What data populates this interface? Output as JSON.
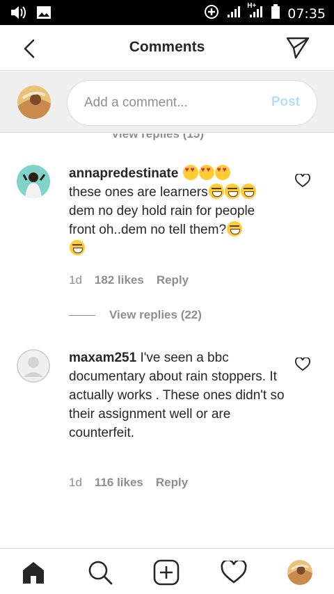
{
  "status_bar": {
    "time": "07:35",
    "network": "H+",
    "icons": [
      "volume-icon",
      "image-icon",
      "data-saver-icon",
      "signal-icon",
      "signal-icon",
      "battery-icon"
    ]
  },
  "header": {
    "title": "Comments",
    "back_icon": "chevron-left-icon",
    "share_icon": "send-icon"
  },
  "composer": {
    "placeholder": "Add a comment...",
    "post_label": "Post",
    "post_color": "#b2dffc"
  },
  "cutoff_row": {
    "label": "View replies (15)"
  },
  "comments": [
    {
      "username": "annapredestinate",
      "body_lines": [
        "these ones are learners",
        "dem no dey hold rain for people",
        "front oh..dem no tell them?"
      ],
      "time": "1d",
      "likes": "182 likes",
      "reply_label": "Reply",
      "view_replies": "View replies (22)"
    },
    {
      "username": "maxam251",
      "body": "I've seen a bbc documentary about rain stoppers. It actually works . These ones didn't so their assignment well or are counterfeit.",
      "time": "1d",
      "likes": "116 likes",
      "reply_label": "Reply"
    }
  ],
  "bottom_nav": {
    "items": [
      "home-icon",
      "search-icon",
      "add-icon",
      "heart-icon",
      "profile-avatar"
    ]
  },
  "colors": {
    "text": "#262626",
    "secondary": "#8e8e8e",
    "divider": "#dbdbdb",
    "composer_bg": "#efefef"
  }
}
